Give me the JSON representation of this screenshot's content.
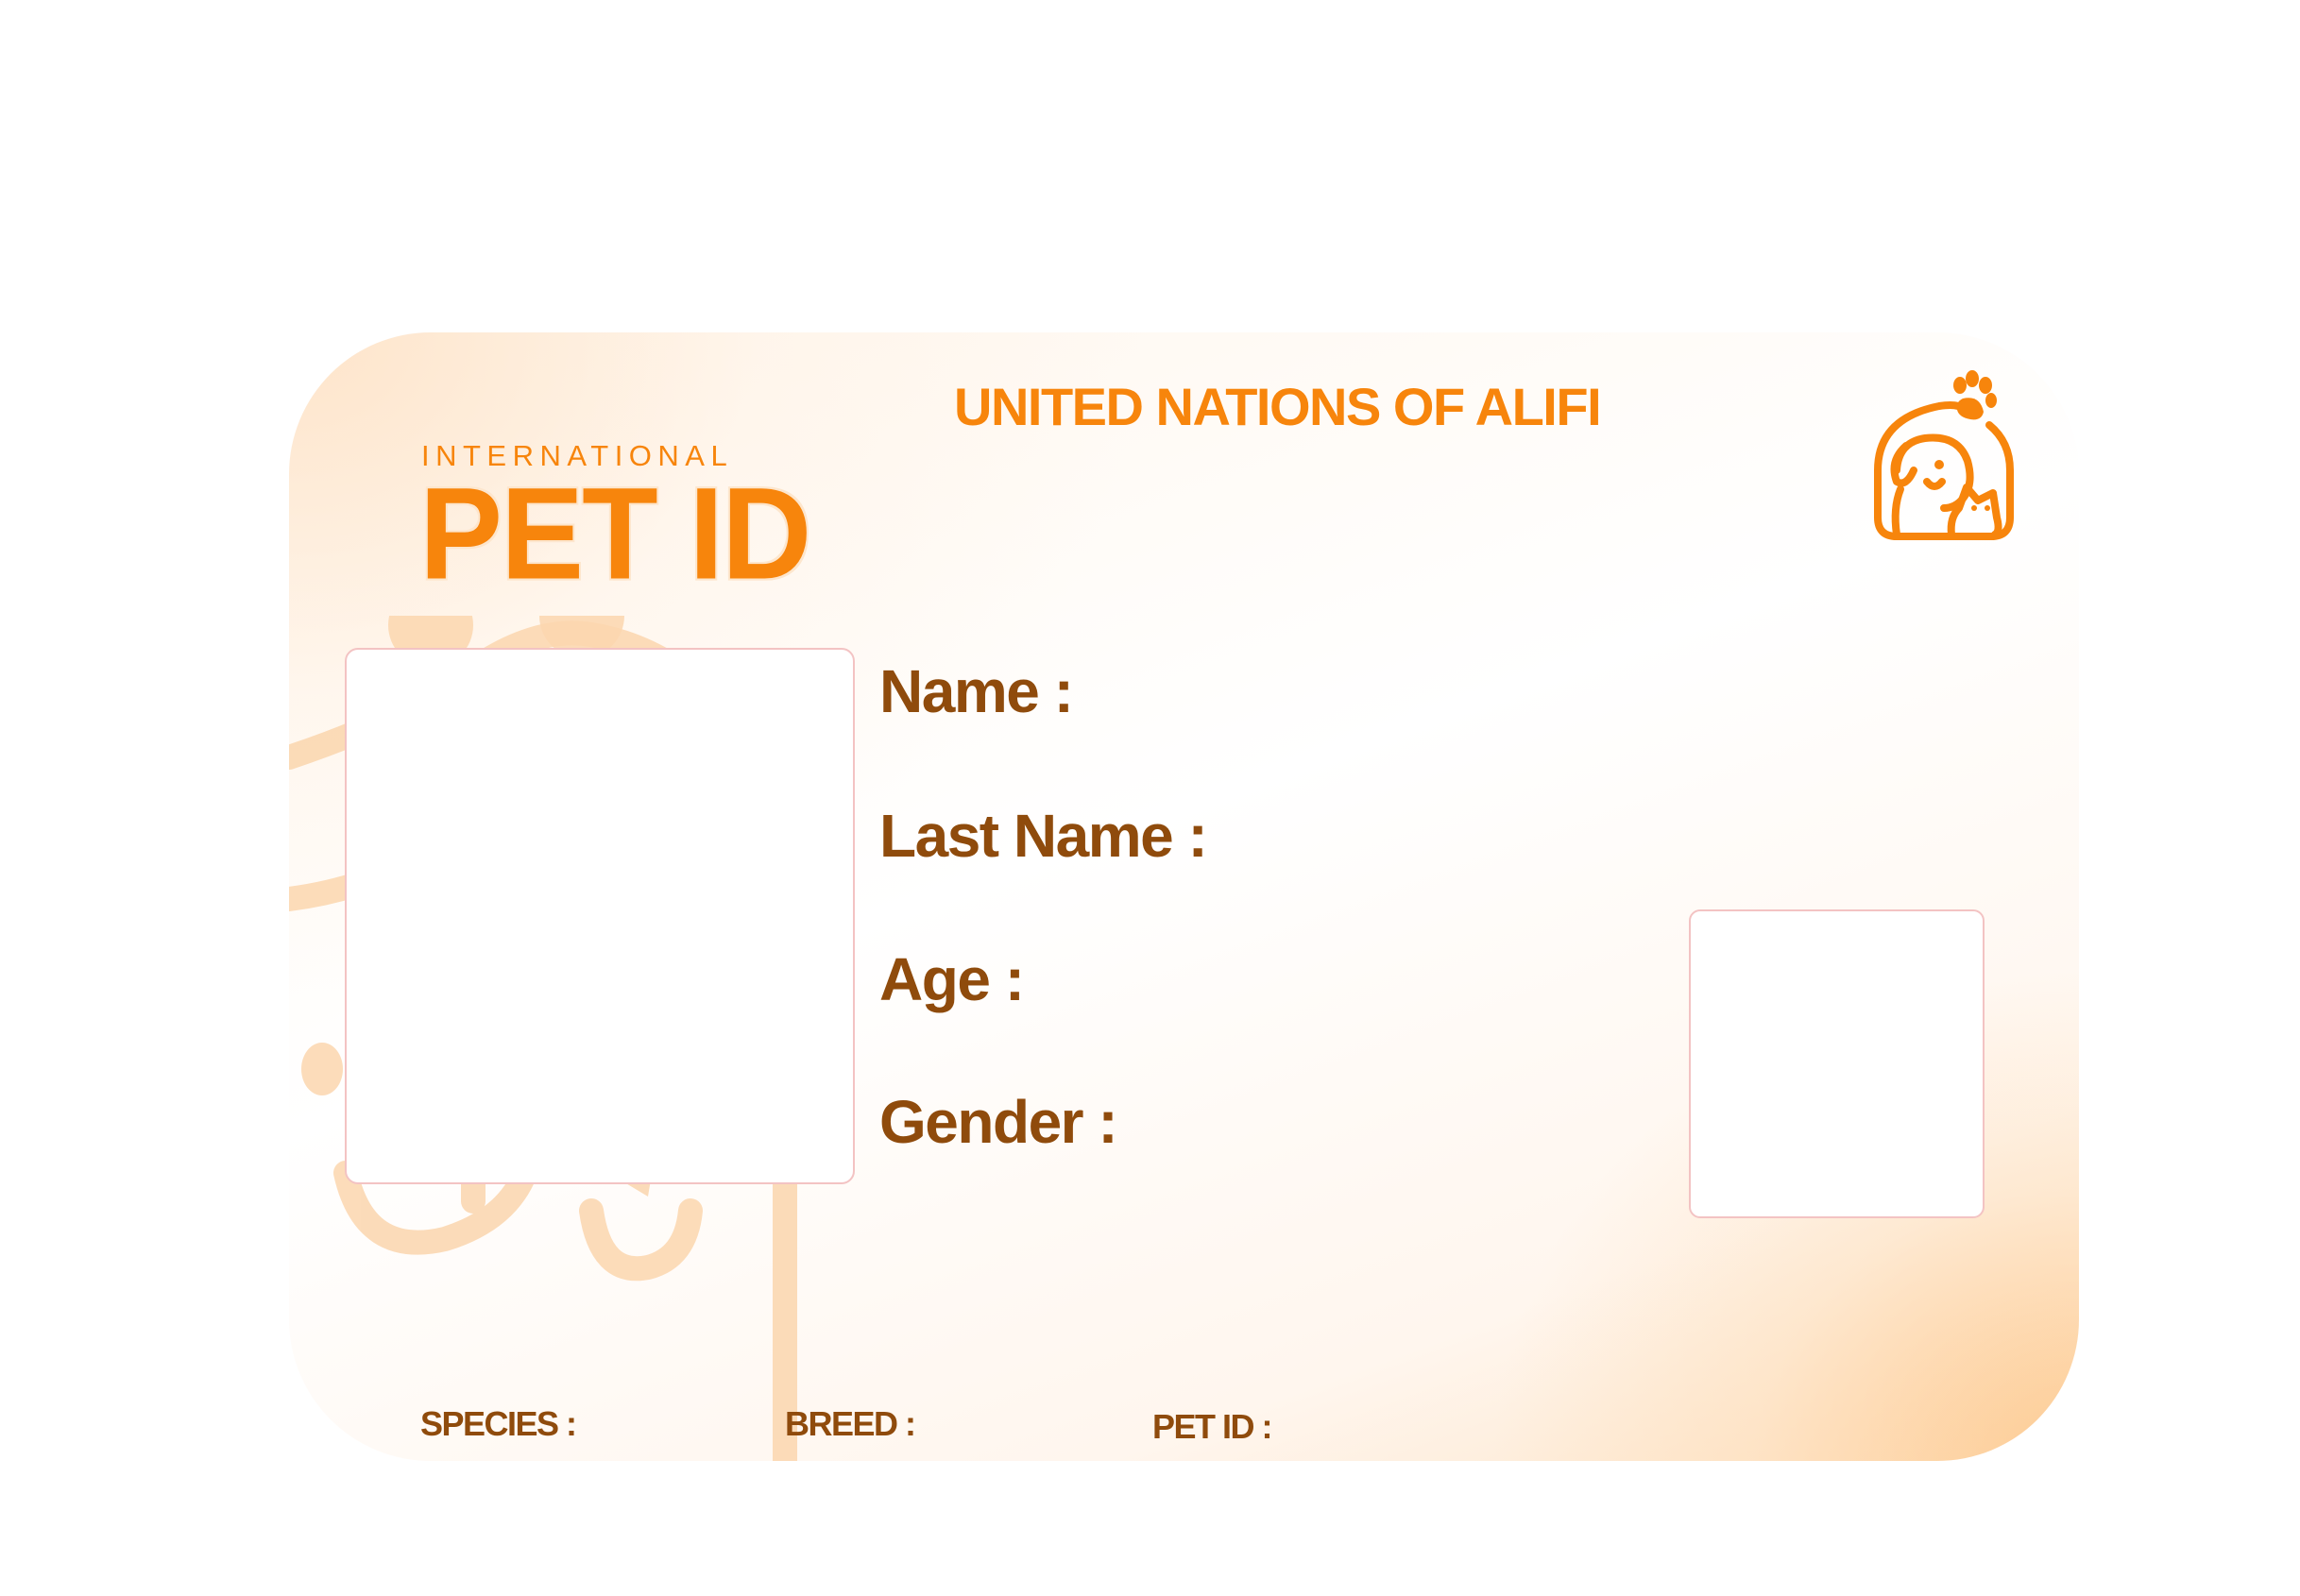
{
  "card": {
    "issuer": "UNITED NATIONS OF ALIFI",
    "logo": {
      "small_text": "INTERNATIONAL",
      "big_text": "PET ID"
    },
    "icons": {
      "emblem": "dog-cat-paw-icon",
      "watermark": "dog-cat-watermark"
    },
    "fields": {
      "name_label": "Name :",
      "last_name_label": "Last Name :",
      "age_label": "Age :",
      "gender_label": "Gender :"
    },
    "footer": {
      "species_label": "SPECIES :",
      "breed_label": "BREED :",
      "pet_id_label": "PET ID :"
    },
    "colors": {
      "accent": "#f7850c",
      "label": "#8f4b0c",
      "watermark": "#fbd0a5"
    }
  }
}
